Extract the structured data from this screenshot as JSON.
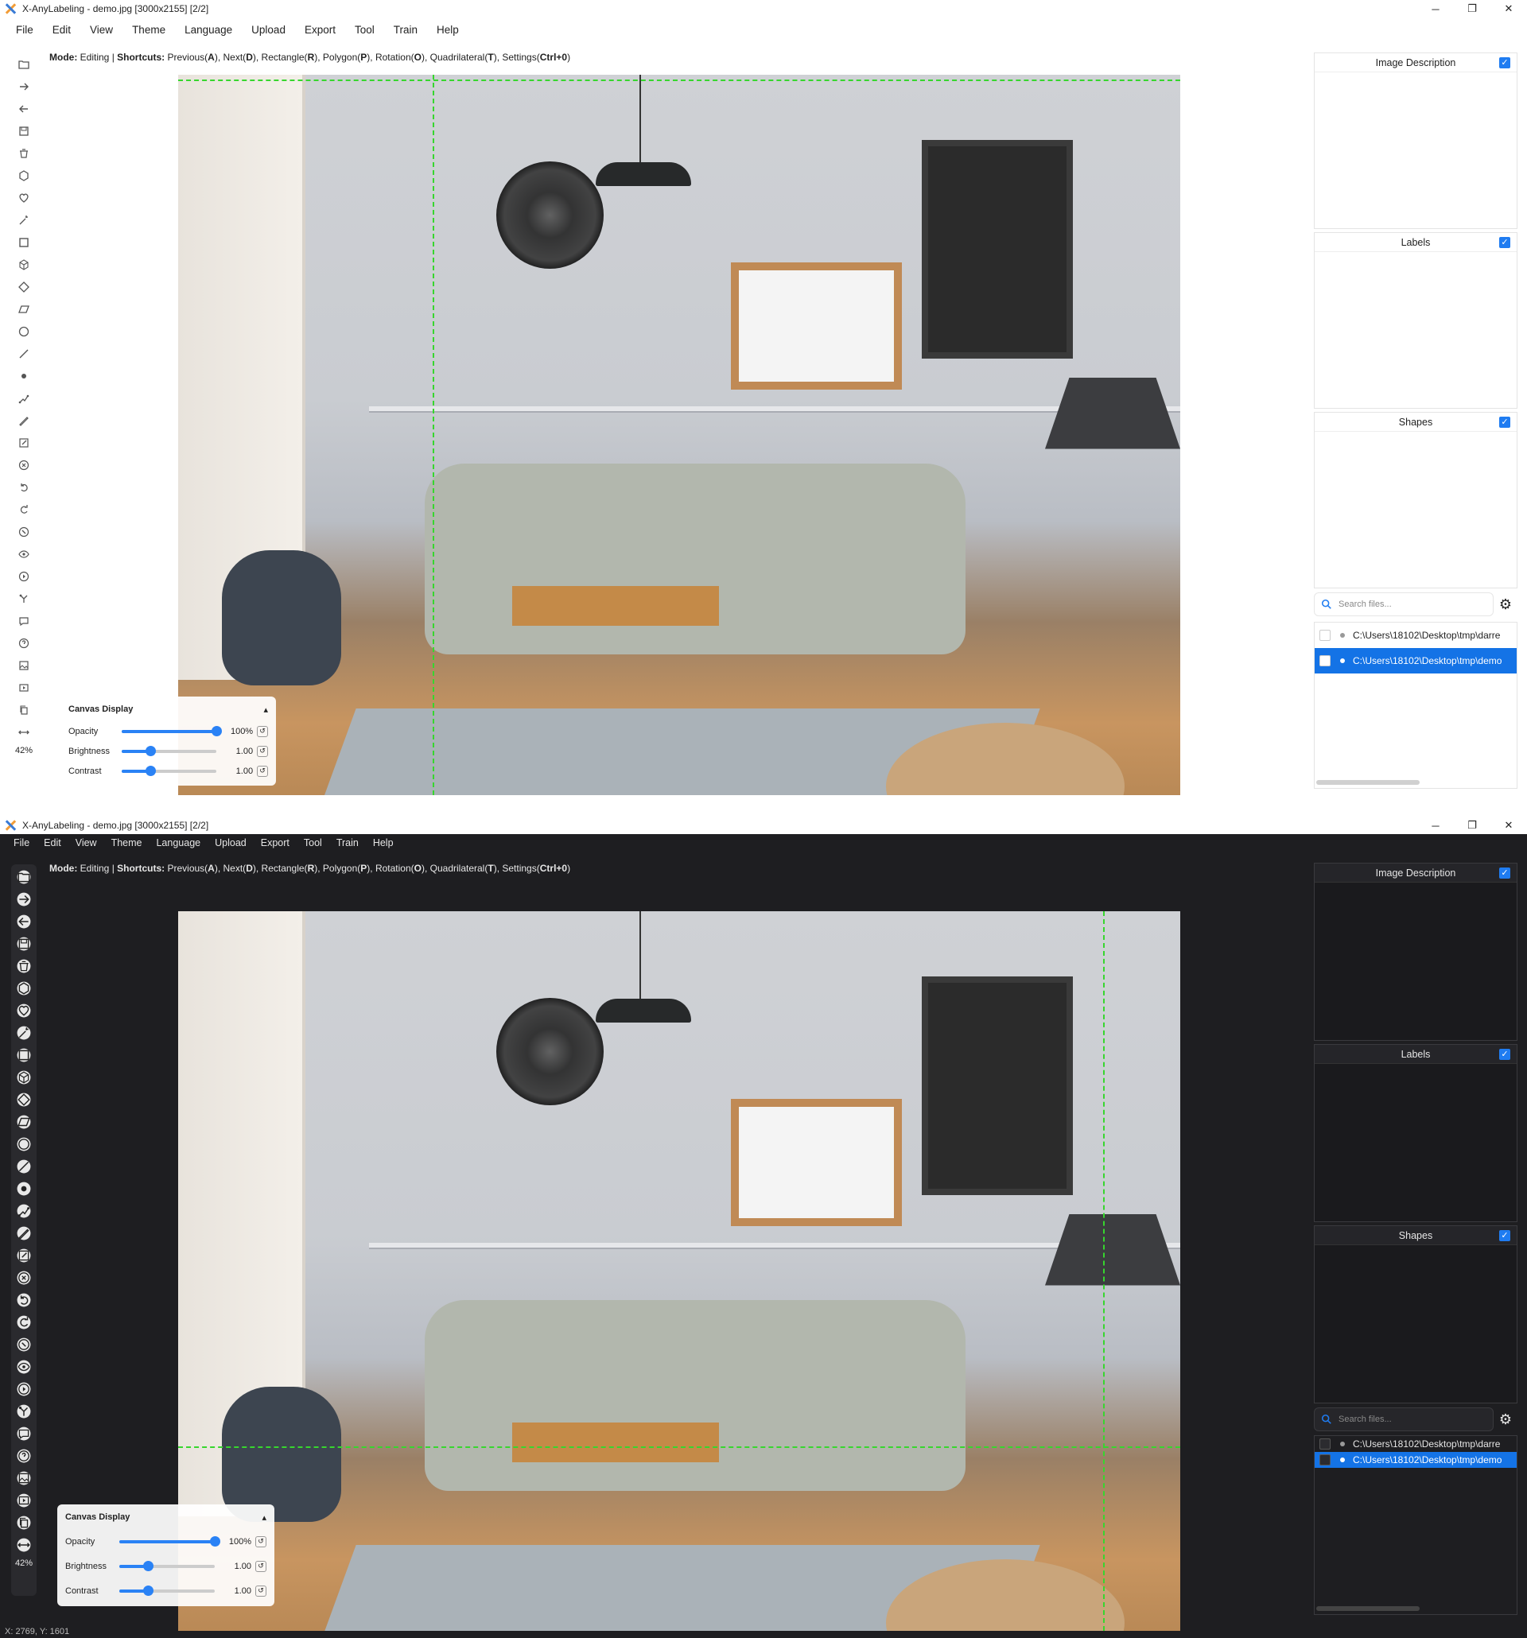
{
  "windows": [
    {
      "theme": "light",
      "title": "X-AnyLabeling - demo.jpg [3000x2155] [2/2]",
      "controls": {
        "minimize": "─",
        "restore": "❐",
        "close": "✕"
      },
      "menu": [
        "File",
        "Edit",
        "View",
        "Theme",
        "Language",
        "Upload",
        "Export",
        "Tool",
        "Train",
        "Help"
      ],
      "mode_bar": {
        "mode_label": "Mode:",
        "mode_value": " Editing | ",
        "shortcuts_label": "Shortcuts:",
        "s1": " Previous(",
        "k1": "A",
        "s2": "), Next(",
        "k2": "D",
        "s3": "), Rectangle(",
        "k3": "R",
        "s4": "), Polygon(",
        "k4": "P",
        "s5": "), Rotation(",
        "k5": "O",
        "s6": "), Quadrilateral(",
        "k6": "T",
        "s7": "), Settings(",
        "k7": "Ctrl+0",
        "s8": ")"
      },
      "zoom": "42%",
      "canvas_display": {
        "title": "Canvas Display",
        "collapse": "▴",
        "opacity": {
          "label": "Opacity",
          "value": "100%",
          "level": 1.0
        },
        "brightness": {
          "label": "Brightness",
          "value": "1.00",
          "level": 0.3
        },
        "contrast": {
          "label": "Contrast",
          "value": "1.00",
          "level": 0.3
        }
      },
      "docks": {
        "image_description": "Image Description",
        "labels": "Labels",
        "shapes": "Shapes"
      },
      "search_placeholder": "Search files...",
      "files": [
        "C:\\Users\\18102\\Desktop\\tmp\\darre",
        "C:\\Users\\18102\\Desktop\\tmp\\demo"
      ],
      "selected_file_index": 1
    },
    {
      "theme": "dark",
      "title": "X-AnyLabeling - demo.jpg [3000x2155] [2/2]",
      "controls": {
        "minimize": "─",
        "restore": "❐",
        "close": "✕"
      },
      "menu": [
        "File",
        "Edit",
        "View",
        "Theme",
        "Language",
        "Upload",
        "Export",
        "Tool",
        "Train",
        "Help"
      ],
      "mode_bar": {
        "mode_label": "Mode:",
        "mode_value": " Editing | ",
        "shortcuts_label": "Shortcuts:",
        "s1": " Previous(",
        "k1": "A",
        "s2": "), Next(",
        "k2": "D",
        "s3": "), Rectangle(",
        "k3": "R",
        "s4": "), Polygon(",
        "k4": "P",
        "s5": "), Rotation(",
        "k5": "O",
        "s6": "), Quadrilateral(",
        "k6": "T",
        "s7": "), Settings(",
        "k7": "Ctrl+0",
        "s8": ")"
      },
      "zoom": "42%",
      "canvas_display": {
        "title": "Canvas Display",
        "collapse": "▴",
        "opacity": {
          "label": "Opacity",
          "value": "100%",
          "level": 1.0
        },
        "brightness": {
          "label": "Brightness",
          "value": "1.00",
          "level": 0.3
        },
        "contrast": {
          "label": "Contrast",
          "value": "1.00",
          "level": 0.3
        }
      },
      "docks": {
        "image_description": "Image Description",
        "labels": "Labels",
        "shapes": "Shapes"
      },
      "search_placeholder": "Search files...",
      "files": [
        "C:\\Users\\18102\\Desktop\\tmp\\darre",
        "C:\\Users\\18102\\Desktop\\tmp\\demo"
      ],
      "selected_file_index": 1,
      "status": "X: 2769, Y: 1601"
    }
  ],
  "toolbar_icons": [
    "open-dir-icon",
    "next-image-icon",
    "prev-image-icon",
    "save-icon",
    "delete-file-icon",
    "polygon-icon",
    "ai-polygon-icon",
    "ai-magic-icon",
    "rectangle-icon",
    "cube-icon",
    "quadrilateral-icon",
    "rotation-icon",
    "circle-icon",
    "line-icon",
    "point-icon",
    "linestrip-icon",
    "brush-icon",
    "edit-icon",
    "delete-shape-icon",
    "undo-icon",
    "redo-icon",
    "auto-label-icon",
    "visibility-icon",
    "play-icon",
    "group-icon",
    "chat-icon",
    "help-icon",
    "image-icon",
    "video-icon",
    "copy-icon",
    "fit-width-icon"
  ],
  "colors": {
    "accent": "#1f7cf1",
    "guide": "#37d62e",
    "selected_row": "#1473e6",
    "dark_bg": "#1e1e21"
  }
}
